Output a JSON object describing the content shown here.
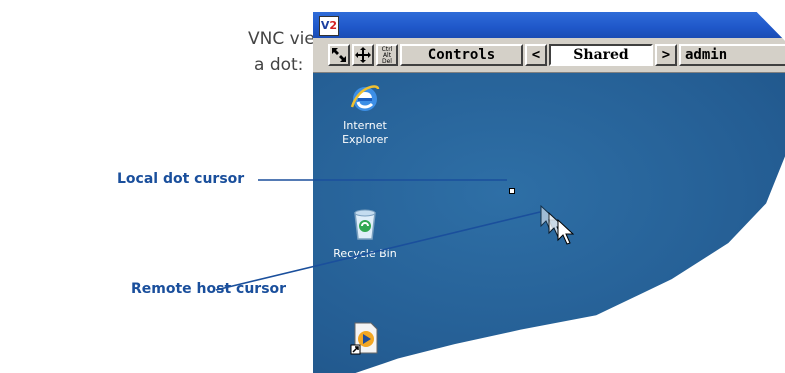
{
  "intro": {
    "line1": "VNC viewer, the local",
    "line2": "a dot:"
  },
  "callouts": {
    "local": "Local dot cursor",
    "remote": "Remote host cursor"
  },
  "window": {
    "logo": "V2",
    "toolbar": {
      "resize_icon": "resize-arrows-icon",
      "move_icon": "move-arrows-icon",
      "cad_label": "Ctrl Alt Del",
      "controls": "Controls",
      "prev": "<",
      "shared": "Shared",
      "next": ">",
      "user": "admin"
    },
    "desktop": {
      "icons": [
        {
          "label": "Internet Explorer",
          "icon": "internet-explorer-icon"
        },
        {
          "label": "Recycle Bin",
          "icon": "recycle-bin-icon"
        },
        {
          "label": "",
          "icon": "media-player-shortcut-icon"
        }
      ]
    }
  },
  "colors": {
    "callout_text": "#1a4f9c",
    "leader_line": "#1a4f9c",
    "titlebar": "#1f57c9",
    "toolbar": "#d4d0c8",
    "desktop": "#245d93"
  }
}
